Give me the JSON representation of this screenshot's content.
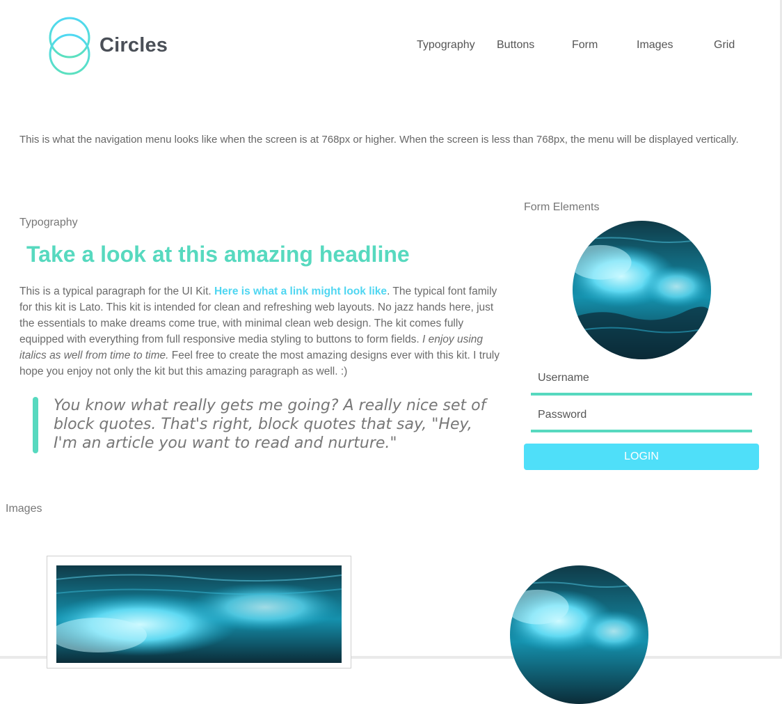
{
  "brand": {
    "name": "Circles",
    "logo_icon": "two-overlapping-circles",
    "colors": {
      "teal": "#57d9bf",
      "cyan": "#4fdff9"
    }
  },
  "nav": {
    "items": [
      "Typography",
      "Buttons",
      "Form",
      "Images",
      "Grid"
    ]
  },
  "intro": "This is what the navigation menu looks like when the screen is at 768px or higher. When the screen is less than 768px, the menu will be displayed vertically.",
  "typography": {
    "label": "Typography",
    "headline": "Take a look at this amazing headline",
    "paragraph": {
      "part1": "This is a typical paragraph for the UI Kit. ",
      "link": "Here is what a link might look like",
      "part2": ". The typical font family for this kit is Lato. This kit is intended for clean and refreshing web layouts. No jazz hands here, just the essentials to make dreams come true, with minimal clean web design. The kit comes fully equipped with everything from full responsive media styling to buttons to form fields. ",
      "italic": "I enjoy using italics as well from time to time.",
      "part3": " Feel free to create the most amazing designs ever with this kit. I truly hope you enjoy not only the kit but this amazing paragraph as well. :)"
    },
    "blockquote": "You know what really gets me going? A really nice set of block quotes. That's right, block quotes that say, \"Hey, I'm an article you want to read and nurture.\""
  },
  "form": {
    "label": "Form Elements",
    "username_placeholder": "Username",
    "password_placeholder": "Password",
    "login_label": "LOGIN"
  },
  "images": {
    "label": "Images"
  }
}
